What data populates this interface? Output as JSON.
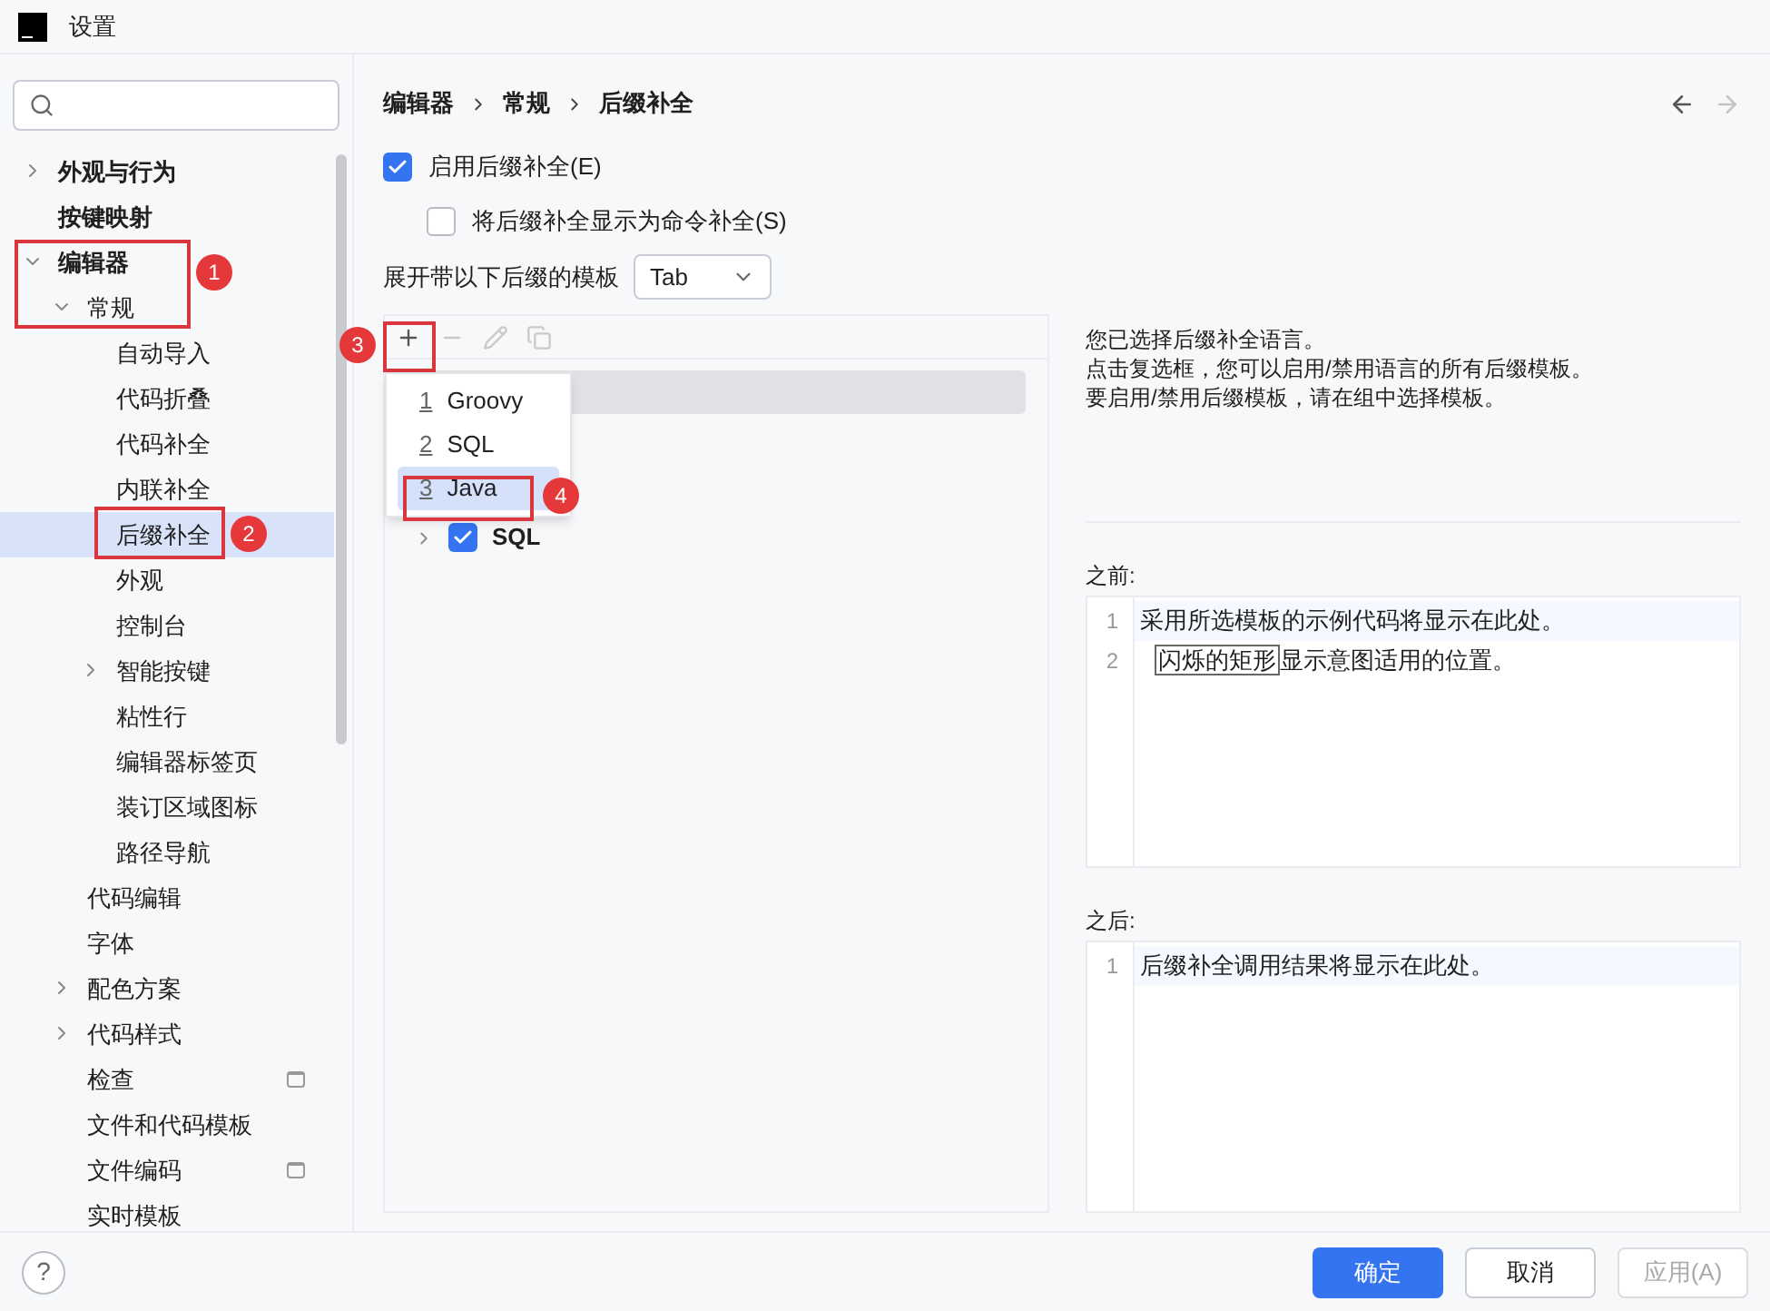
{
  "window": {
    "title": "设置"
  },
  "help": {
    "label": "?"
  },
  "sidebar": {
    "items": [
      {
        "label": "外观与行为",
        "bold": true,
        "expanded": false,
        "selected": false
      },
      {
        "label": "按键映射",
        "bold": true,
        "selected": false
      },
      {
        "label": "编辑器",
        "bold": true,
        "expanded": true,
        "selected": false,
        "children": [
          {
            "label": "常规",
            "expanded": true,
            "selected": false,
            "children": [
              {
                "label": "自动导入",
                "selected": false
              },
              {
                "label": "代码折叠",
                "selected": false
              },
              {
                "label": "代码补全",
                "selected": false
              },
              {
                "label": "内联补全",
                "selected": false
              },
              {
                "label": "后缀补全",
                "selected": true
              },
              {
                "label": "外观",
                "selected": false
              },
              {
                "label": "控制台",
                "selected": false
              },
              {
                "label": "智能按键",
                "expanded": false,
                "selected": false
              },
              {
                "label": "粘性行",
                "selected": false
              },
              {
                "label": "编辑器标签页",
                "selected": false
              },
              {
                "label": "装订区域图标",
                "selected": false
              },
              {
                "label": "路径导航",
                "selected": false
              }
            ]
          },
          {
            "label": "代码编辑",
            "selected": false
          },
          {
            "label": "字体",
            "selected": false
          },
          {
            "label": "配色方案",
            "expanded": false,
            "selected": false
          },
          {
            "label": "代码样式",
            "expanded": false,
            "selected": false
          },
          {
            "label": "检查",
            "scope_icon": true,
            "selected": false
          },
          {
            "label": "文件和代码模板",
            "selected": false
          },
          {
            "label": "文件编码",
            "scope_icon": true,
            "selected": false
          },
          {
            "label": "实时模板",
            "selected": false
          }
        ]
      }
    ]
  },
  "breadcrumb": [
    "编辑器",
    "常规",
    "后缀补全"
  ],
  "nav": {
    "back_disabled": false,
    "forward_disabled": true
  },
  "options": [
    {
      "label": "启用后缀补全(E)",
      "checked": true
    },
    {
      "label": "将后缀补全显示为命令补全(S)",
      "checked": false
    }
  ],
  "expand_key": {
    "label": "展开带以下后缀的模板",
    "value": "Tab"
  },
  "toolbar": [
    {
      "kind": "add",
      "disabled": false
    },
    {
      "kind": "remove",
      "disabled": true
    },
    {
      "kind": "edit",
      "disabled": true
    },
    {
      "kind": "copy",
      "disabled": true
    }
  ],
  "templates": [
    {
      "selected": true
    },
    {
      "label": "SQL",
      "checked": true,
      "expanded": false,
      "selected": false
    }
  ],
  "add_menu": {
    "items": [
      {
        "mnemonic": "1",
        "label": "Groovy",
        "selected": false
      },
      {
        "mnemonic": "2",
        "label": "SQL",
        "selected": false
      },
      {
        "mnemonic": "3",
        "label": "Java",
        "selected": true
      }
    ]
  },
  "description": [
    "您已选择后缀补全语言。",
    "点击复选框，您可以启用/禁用语言的所有后缀模板。",
    "要启用/禁用后缀模板，请在组中选择模板。"
  ],
  "before": {
    "label": "之前:",
    "lines": [
      {
        "number": "1",
        "text": "采用所选模板的示例代码将显示在此处。"
      },
      {
        "number": "2",
        "boxed": "闪烁的矩形",
        "text": "显示意图适用的位置。"
      }
    ]
  },
  "after": {
    "label": "之后:",
    "lines": [
      {
        "number": "1",
        "text": "后缀补全调用结果将显示在此处。"
      }
    ]
  },
  "buttons": [
    {
      "label": "确定",
      "kind": "primary",
      "disabled": false
    },
    {
      "label": "取消",
      "kind": "secondary",
      "disabled": false
    },
    {
      "label": "应用(A)",
      "kind": "secondary",
      "disabled": true
    }
  ],
  "annotations": [
    {
      "label": "1"
    },
    {
      "label": "2"
    },
    {
      "label": "3"
    },
    {
      "label": "4"
    }
  ]
}
